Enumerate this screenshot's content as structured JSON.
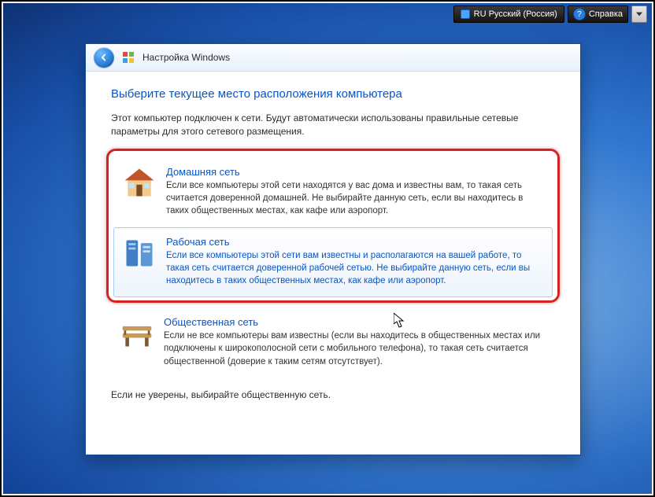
{
  "taskbar": {
    "language_label": "RU Русский (Россия)",
    "help_label": "Справка"
  },
  "dialog": {
    "title": "Настройка Windows",
    "heading": "Выберите текущее место расположения компьютера",
    "intro": "Этот компьютер подключен к сети. Будут автоматически использованы правильные сетевые параметры для этого сетевого размещения.",
    "options": {
      "home": {
        "title": "Домашняя сеть",
        "desc": "Если все компьютеры этой сети находятся у вас дома и известны вам, то такая сеть считается доверенной домашней. Не выбирайте данную сеть, если вы находитесь в таких общественных местах, как кафе или аэропорт."
      },
      "work": {
        "title": "Рабочая сеть",
        "desc": "Если все компьютеры этой сети вам известны и располагаются на вашей работе, то такая сеть считается доверенной рабочей сетью. Не выбирайте данную сеть, если вы находитесь в таких общественных местах, как кафе или аэропорт."
      },
      "public": {
        "title": "Общественная сеть",
        "desc": "Если не все компьютеры вам известны (если вы находитесь в общественных местах или подключены к широкополосной сети с мобильного телефона), то такая сеть считается общественной (доверие к таким сетям отсутствует)."
      }
    },
    "footnote": "Если не уверены, выбирайте общественную сеть."
  }
}
